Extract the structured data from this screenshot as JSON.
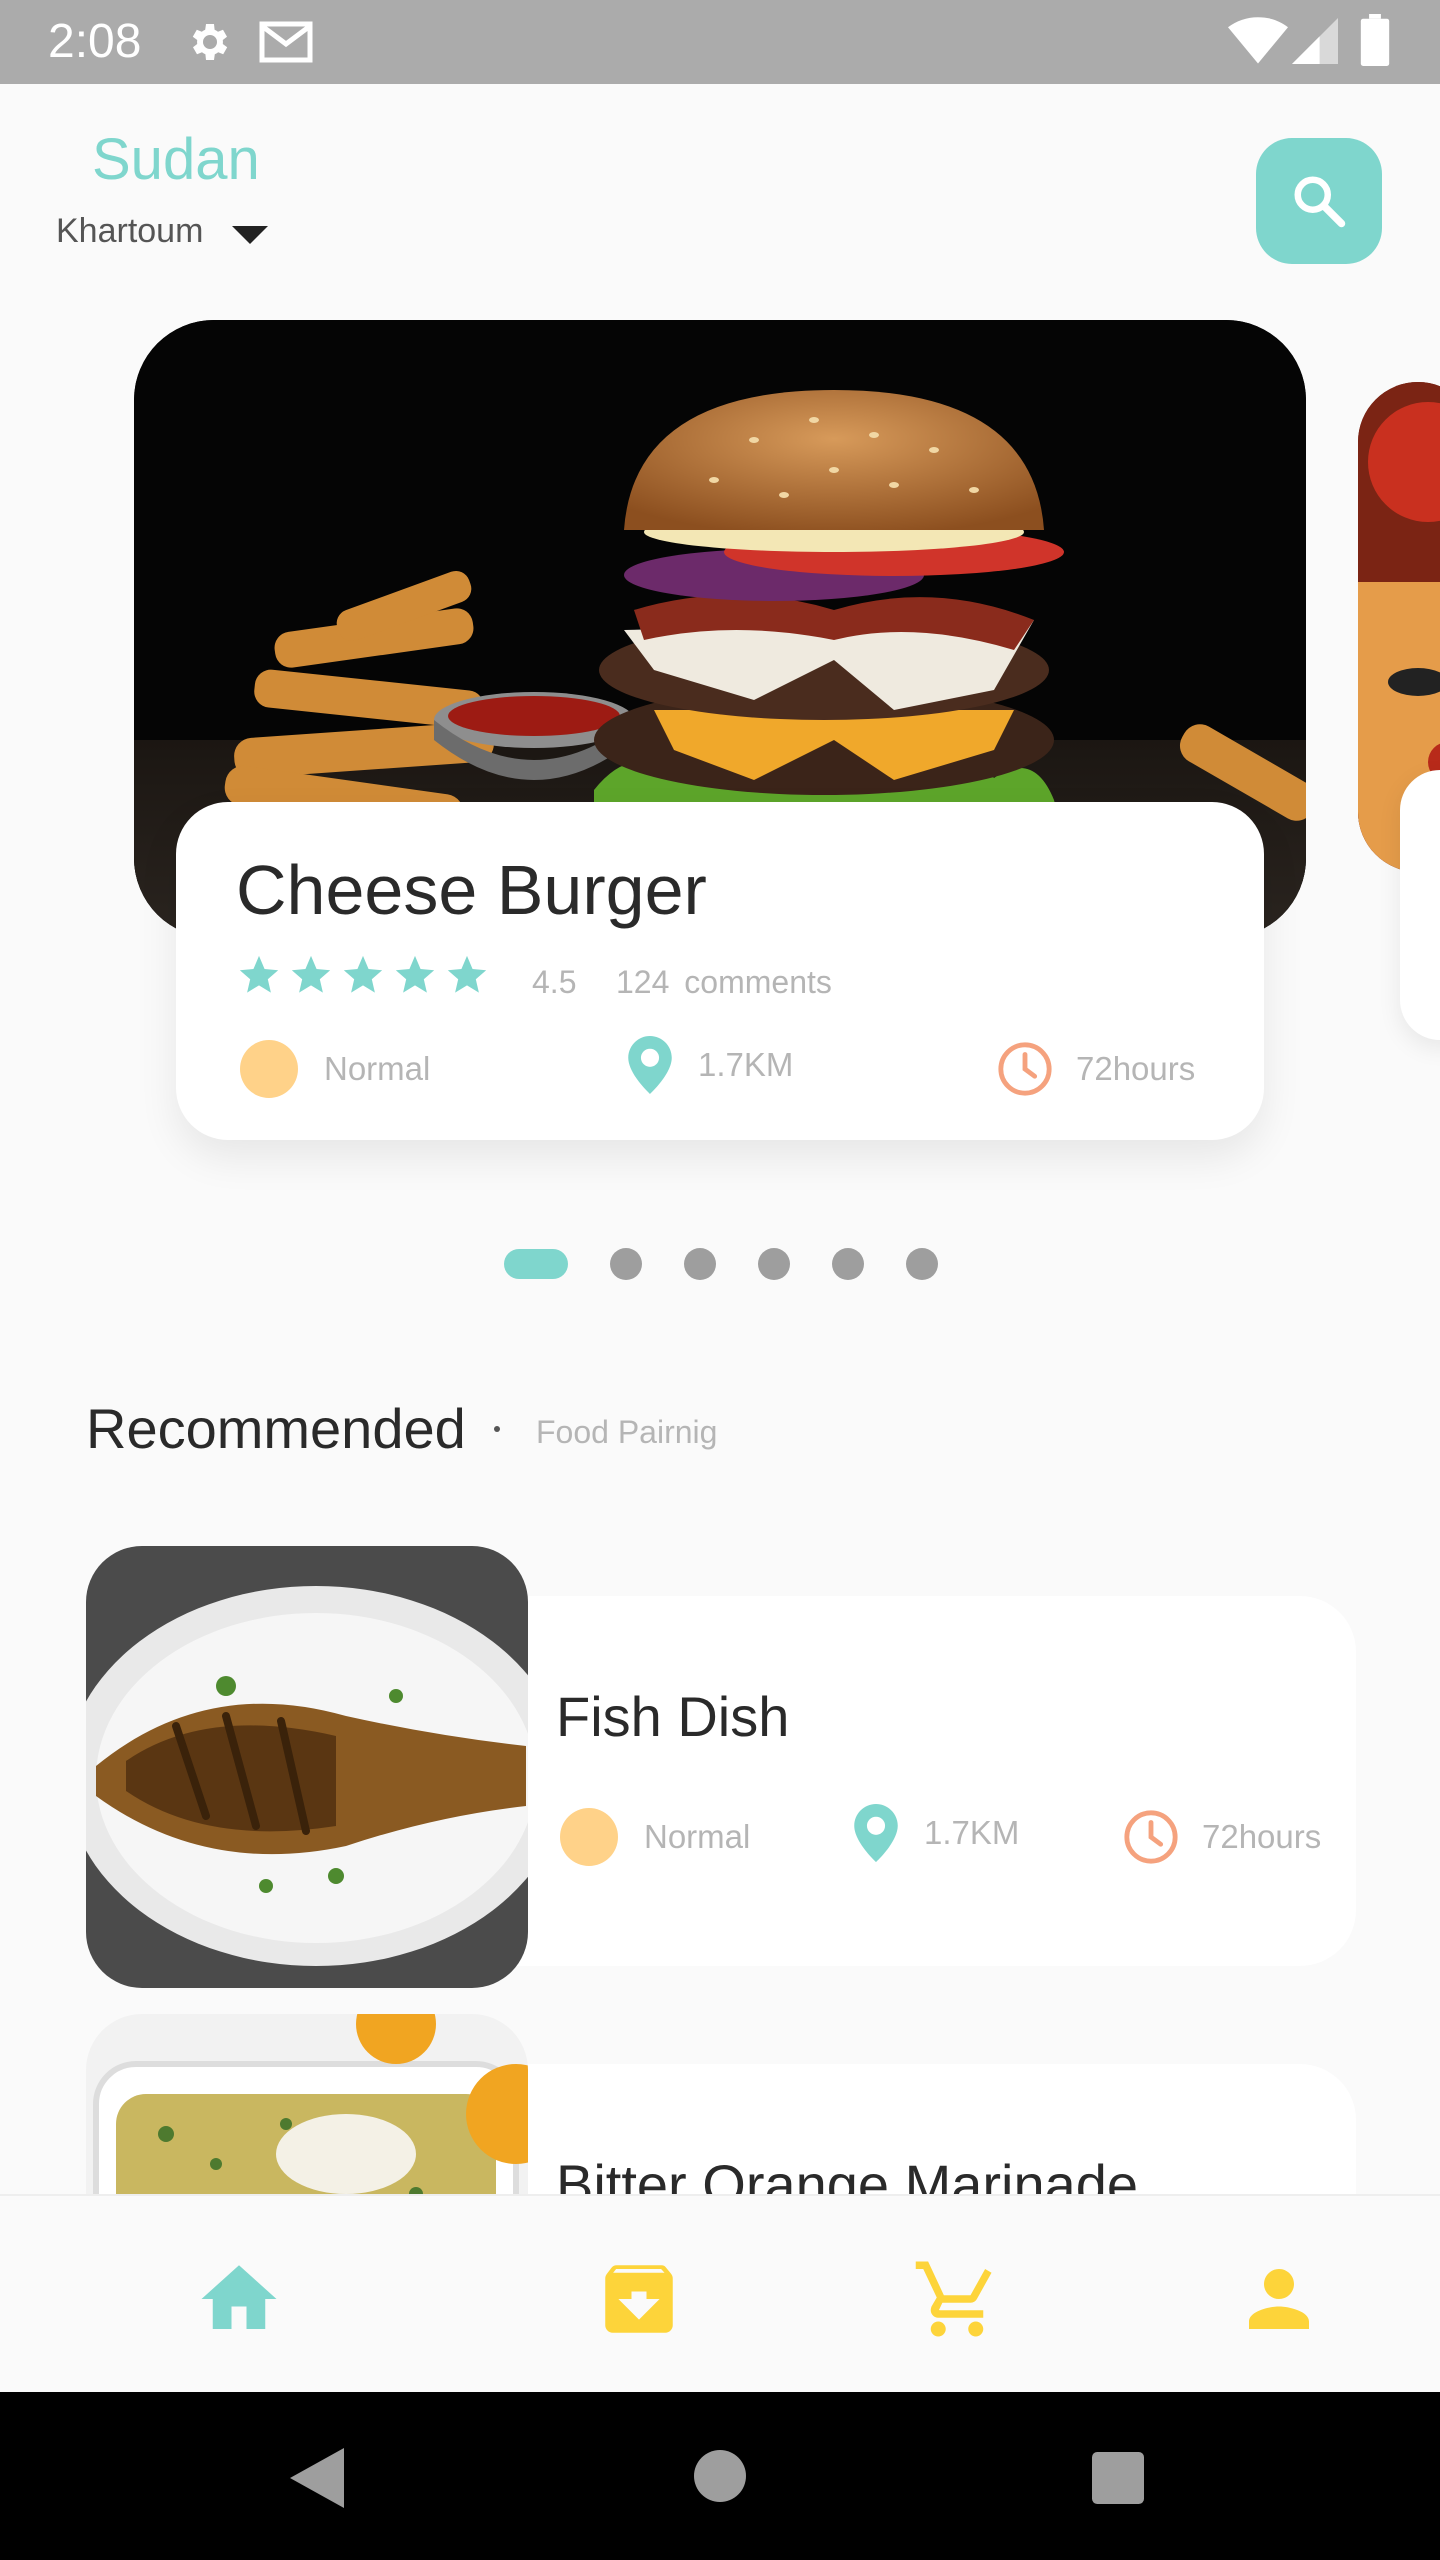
{
  "status_bar": {
    "time": "2:08"
  },
  "header": {
    "country": "Sudan",
    "city": "Khartoum"
  },
  "featured": {
    "title": "Cheese Burger",
    "rating": "4.5",
    "stars": 5,
    "comments_count": "124",
    "comments_label": "comments",
    "level": "Normal",
    "distance": "1.7KM",
    "duration": "72hours"
  },
  "carousel": {
    "pages": 6,
    "active_index": 0
  },
  "recommended": {
    "title": "Recommended",
    "subtitle": "Food Pairnig",
    "items": [
      {
        "name": "Fish Dish",
        "level": "Normal",
        "distance": "1.7KM",
        "duration": "72hours"
      },
      {
        "name": "Bitter Orange Marinade"
      }
    ]
  },
  "bottom_nav": [
    "home-icon",
    "archive-download-icon",
    "cart-icon",
    "profile-icon"
  ],
  "colors": {
    "accent": "#7FD6CD",
    "yellow": "#FDD43A",
    "orange": "#F5A27E",
    "peach": "#FFD289"
  }
}
